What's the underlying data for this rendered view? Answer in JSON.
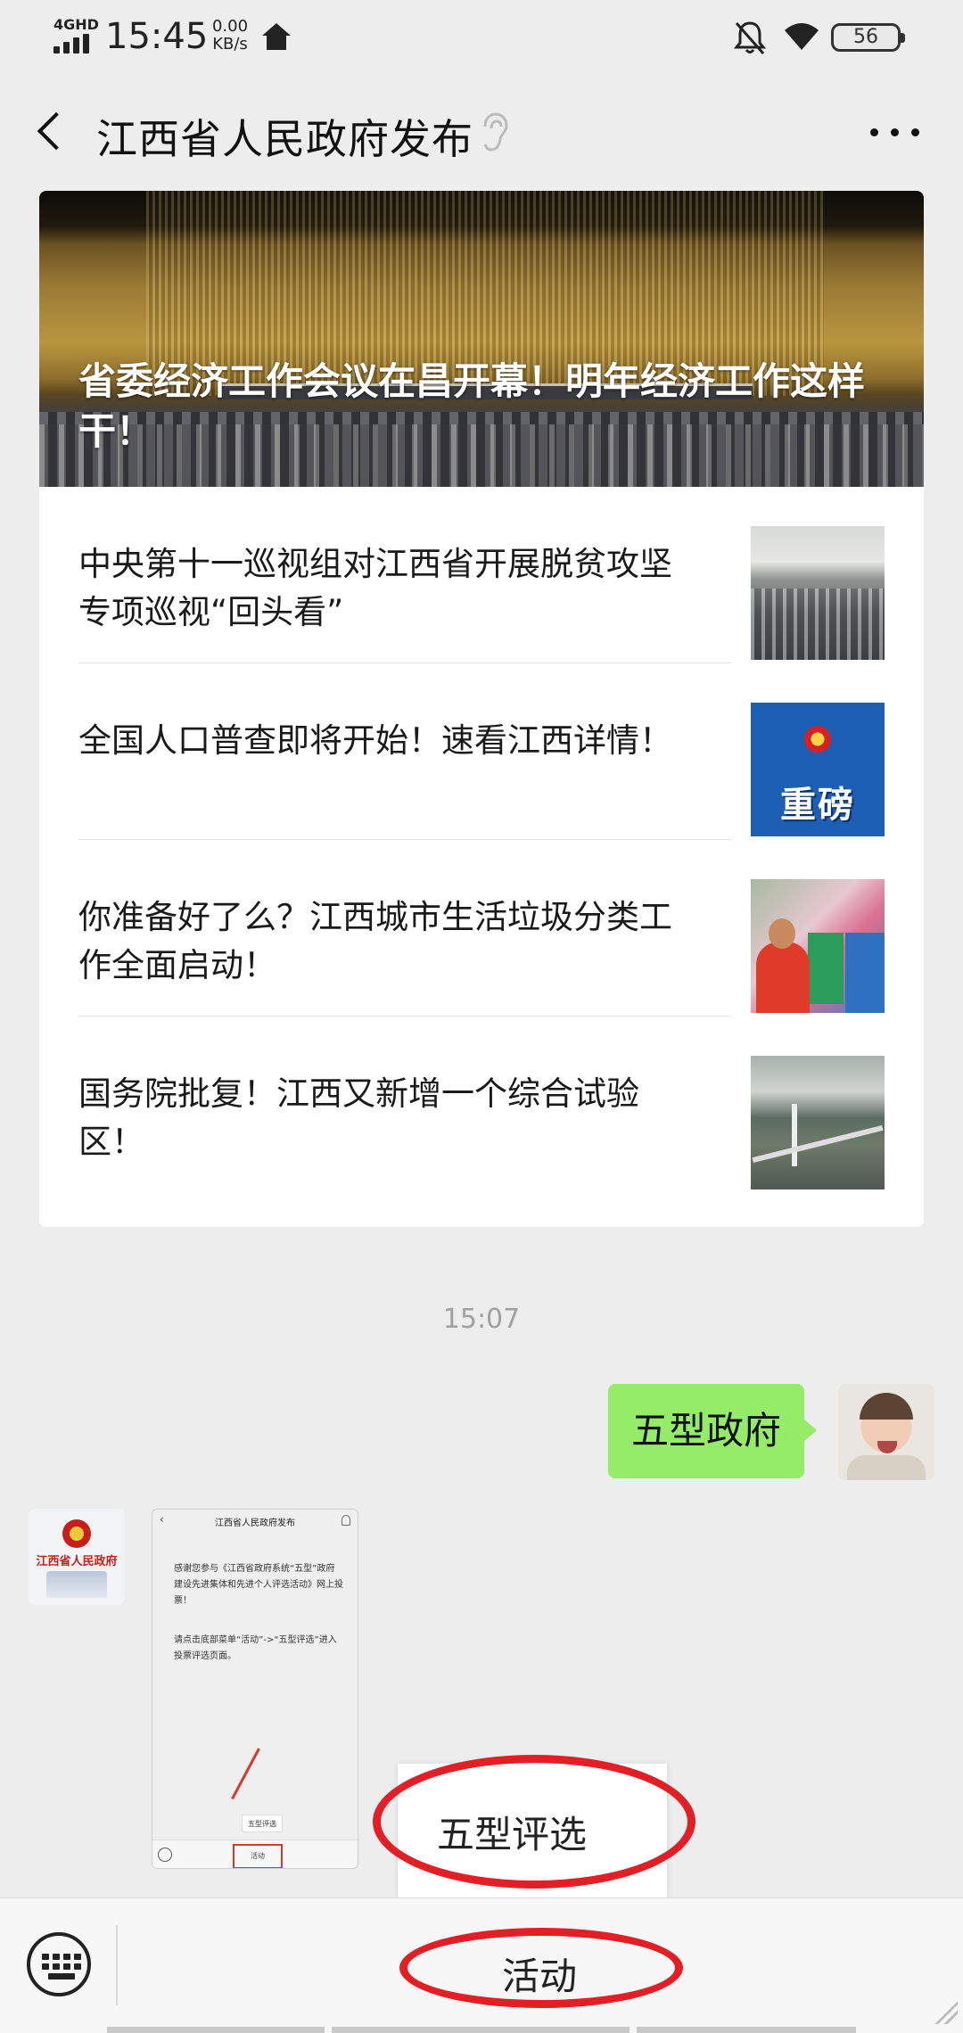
{
  "status_bar": {
    "network": "4GHD",
    "time": "15:45",
    "speed_value": "0.00",
    "speed_unit": "KB/s",
    "battery": "56"
  },
  "header": {
    "title": "江西省人民政府发布"
  },
  "articles": {
    "hero_title": "省委经济工作会议在昌开幕！明年经济工作这样干！",
    "items": [
      {
        "title": "中央第十一巡视组对江西省开展脱贫攻坚专项巡视“回头看”"
      },
      {
        "title": "全国人口普查即将开始！速看江西详情！"
      },
      {
        "title": "你准备好了么？江西城市生活垃圾分类工作全面启动！"
      },
      {
        "title": "国务院批复！江西又新增一个综合试验区！"
      }
    ],
    "thumb2_text": "重磅"
  },
  "chat": {
    "time": "15:07",
    "my_message": "五型政府",
    "image_message": {
      "header_title": "江西省人民政府发布",
      "paragraph1": "感谢您参与《江西省政府系统“五型”政府建设先进集体和先进个人评选活动》网上投票！",
      "paragraph2": "请点击底部菜单“活动”->“五型评选”进入投票评选页面。",
      "popup_label": "五型评选",
      "tab_label": "活动"
    }
  },
  "menu": {
    "popup_item": "五型评选",
    "tab_activity": "活动"
  },
  "colors": {
    "bubble_green": "#95ec69",
    "annotation_red": "#e31e24",
    "background": "#ededed"
  },
  "icons": {
    "back": "back-arrow-icon",
    "more": "more-dots-icon",
    "ear": "ear-icon",
    "keyboard": "keyboard-icon"
  }
}
